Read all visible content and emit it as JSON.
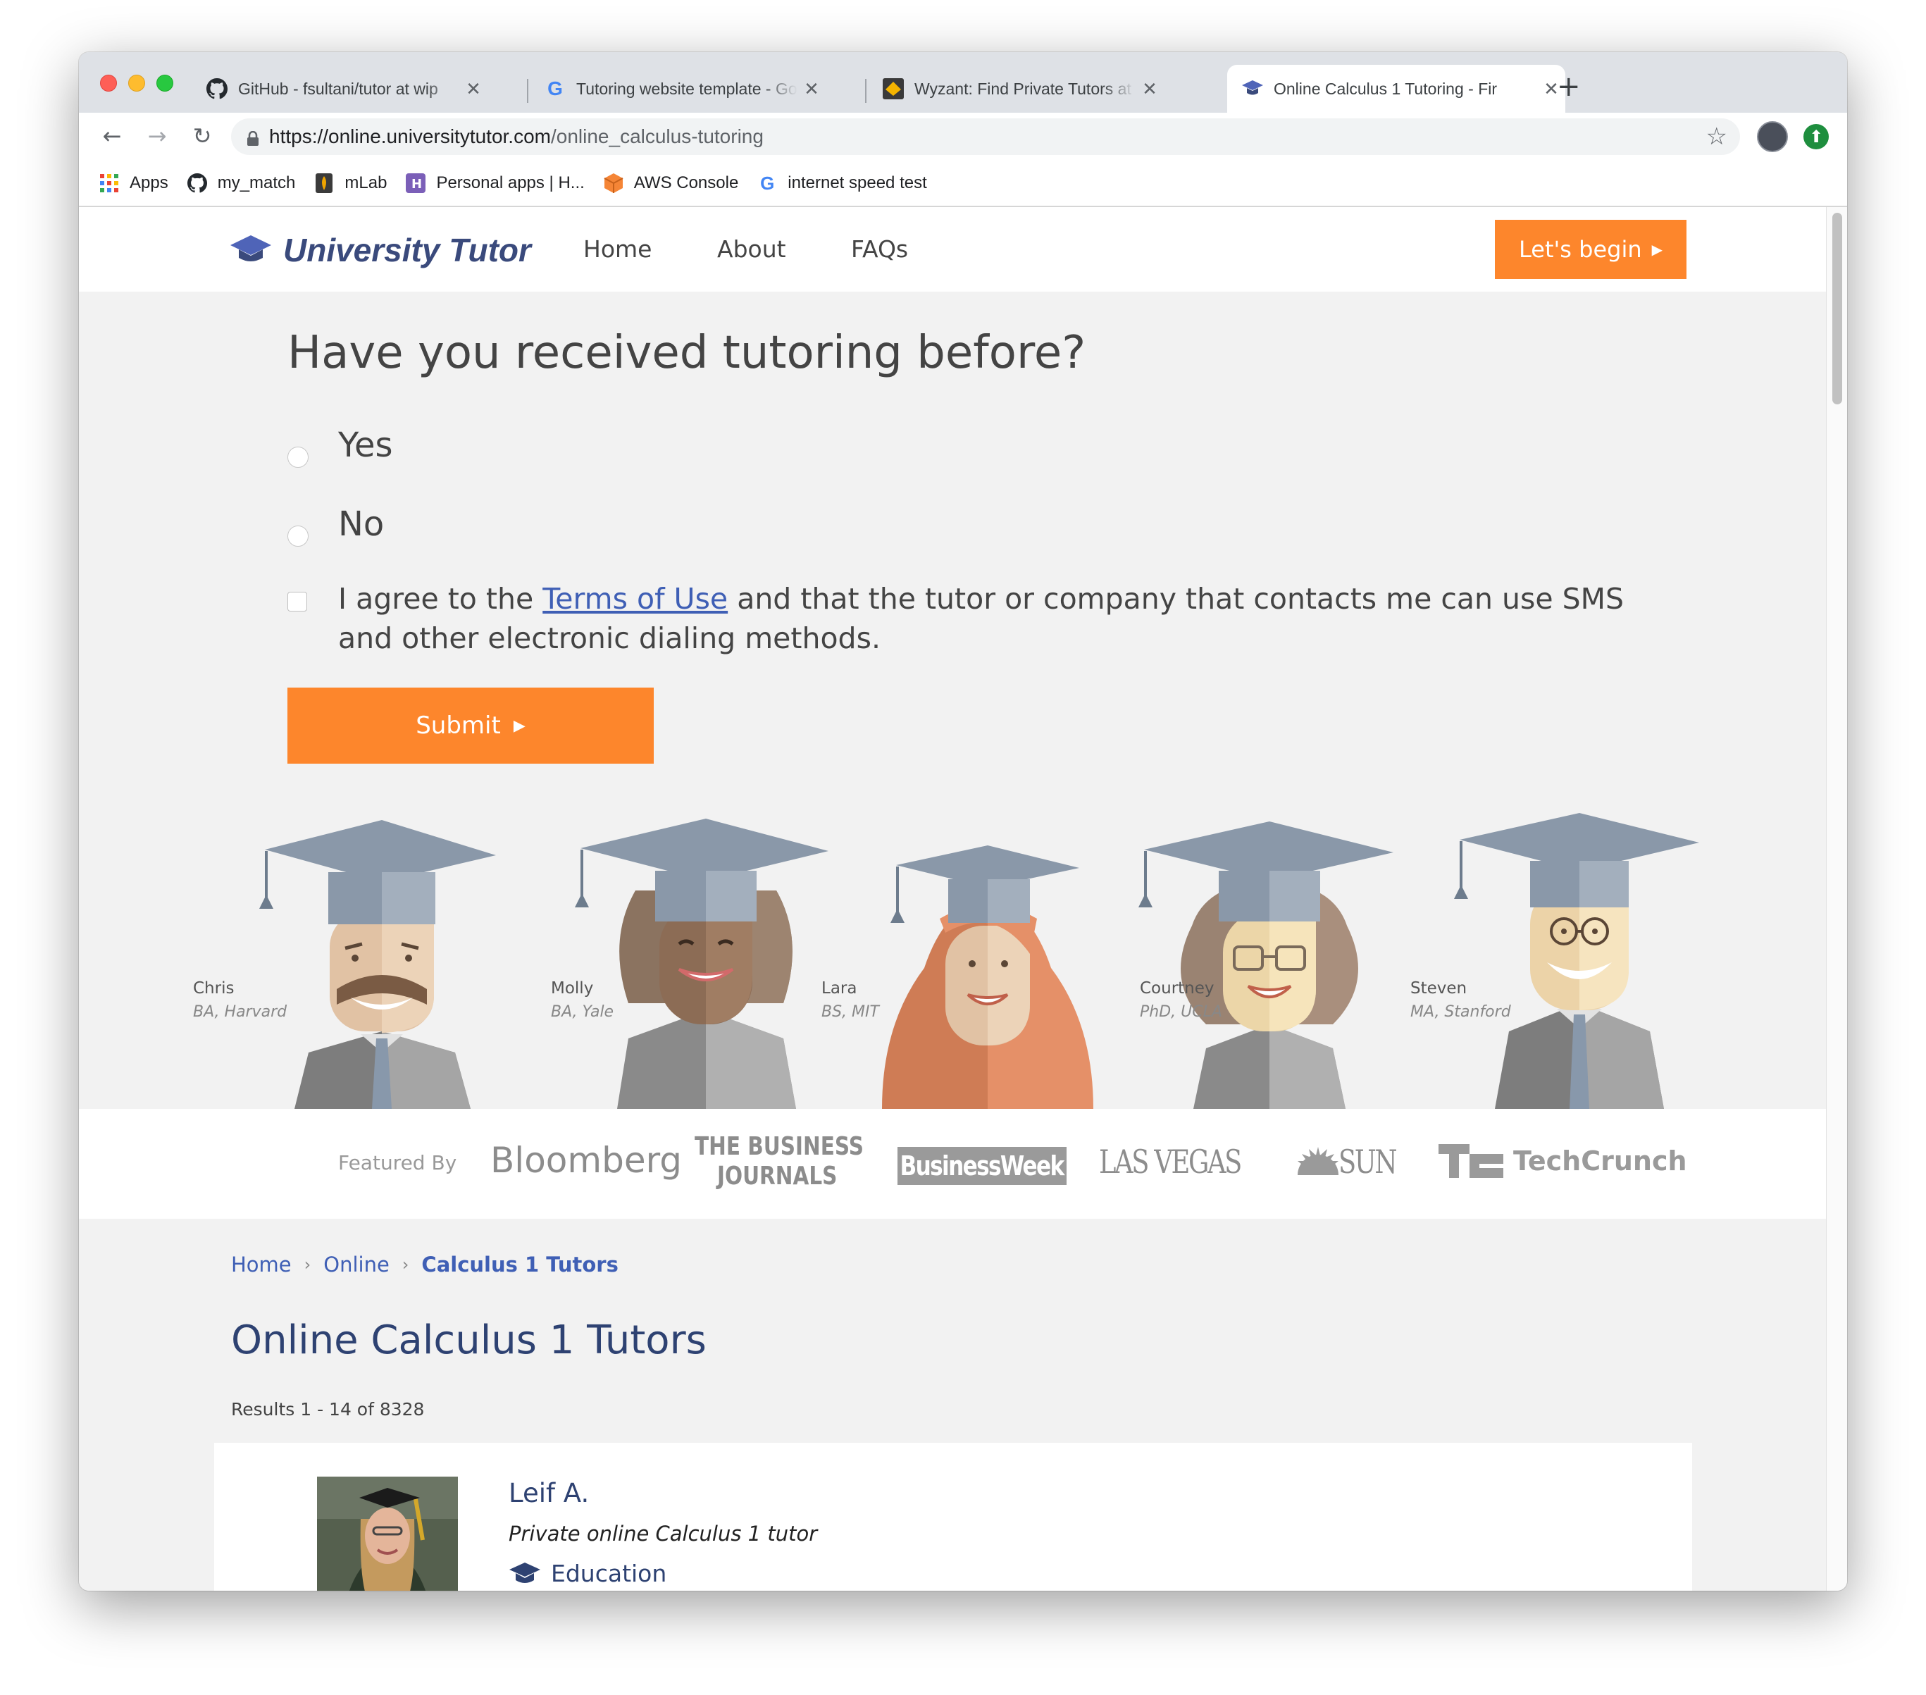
{
  "browser": {
    "tabs": [
      {
        "title": "GitHub - fsultani/tutor at wip",
        "icon": "github-icon"
      },
      {
        "title": "Tutoring website template - Go",
        "icon": "google-icon"
      },
      {
        "title": "Wyzant: Find Private Tutors at",
        "icon": "wyzant-icon"
      },
      {
        "title": "Online Calculus 1 Tutoring - Fir",
        "icon": "graduation-cap-icon"
      }
    ],
    "url_host": "https://online.universitytutor.com",
    "url_path": "/online_calculus-tutoring",
    "bookmarks": [
      {
        "label": "Apps",
        "icon": "apps-grid-icon"
      },
      {
        "label": "my_match",
        "icon": "github-icon"
      },
      {
        "label": "mLab",
        "icon": "mlab-icon"
      },
      {
        "label": "Personal apps | H...",
        "icon": "heroku-icon"
      },
      {
        "label": "AWS Console",
        "icon": "aws-cube-icon"
      },
      {
        "label": "internet speed test",
        "icon": "google-icon"
      }
    ]
  },
  "site": {
    "brand": "University Tutor",
    "nav": [
      "Home",
      "About",
      "FAQs"
    ],
    "cta": "Let's begin",
    "question": "Have you received tutoring before?",
    "options": [
      "Yes",
      "No"
    ],
    "terms_before": "I agree to the ",
    "terms_link": "Terms of Use",
    "terms_after": " and that the tutor or company that contacts me can use SMS and other electronic dialing methods.",
    "submit": "Submit",
    "tutors": [
      {
        "name": "Chris",
        "degree": "BA, Harvard"
      },
      {
        "name": "Molly",
        "degree": "BA, Yale"
      },
      {
        "name": "Lara",
        "degree": "BS, MIT"
      },
      {
        "name": "Courtney",
        "degree": "PhD, UCLA"
      },
      {
        "name": "Steven",
        "degree": "MA, Stanford"
      }
    ],
    "featured_label": "Featured By",
    "press": [
      "Bloomberg",
      "THE BUSINESS",
      "JOURNALS",
      "BusinessWeek",
      "LAS VEGAS",
      "SUN",
      "TechCrunch"
    ],
    "breadcrumbs": [
      "Home",
      "Online",
      "Calculus 1 Tutors"
    ],
    "heading": "Online Calculus 1 Tutors",
    "results": "Results 1 - 14 of 8328",
    "first_tutor": {
      "name": "Leif A.",
      "description": "Private online Calculus 1 tutor",
      "education": "Education"
    }
  },
  "colors": {
    "accent_orange": "#fd862c",
    "brand_navy": "#3a4a7c",
    "link_blue": "#3f5fb5"
  }
}
